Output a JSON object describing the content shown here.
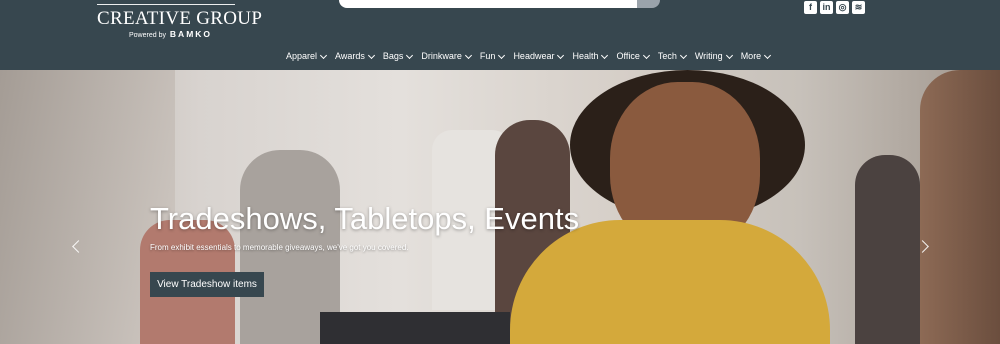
{
  "logo": {
    "main": "CREATIVE GROUP",
    "powered_by": "Powered by",
    "brand": "BAMKO"
  },
  "search": {
    "placeholder": ""
  },
  "social": {
    "items": [
      "f",
      "in",
      "◎",
      "≋"
    ]
  },
  "nav": {
    "items": [
      "Apparel",
      "Awards",
      "Bags",
      "Drinkware",
      "Fun",
      "Headwear",
      "Health",
      "Office",
      "Tech",
      "Writing",
      "More"
    ]
  },
  "hero": {
    "title": "Tradeshows, Tabletops, Events",
    "subtitle": "From exhibit essentials to memorable giveaways, we've got you covered.",
    "button_label": "View Tradeshow items"
  },
  "colors": {
    "header": "#37474f",
    "button": "#37474f",
    "accent_yellow": "#d4a93b"
  }
}
